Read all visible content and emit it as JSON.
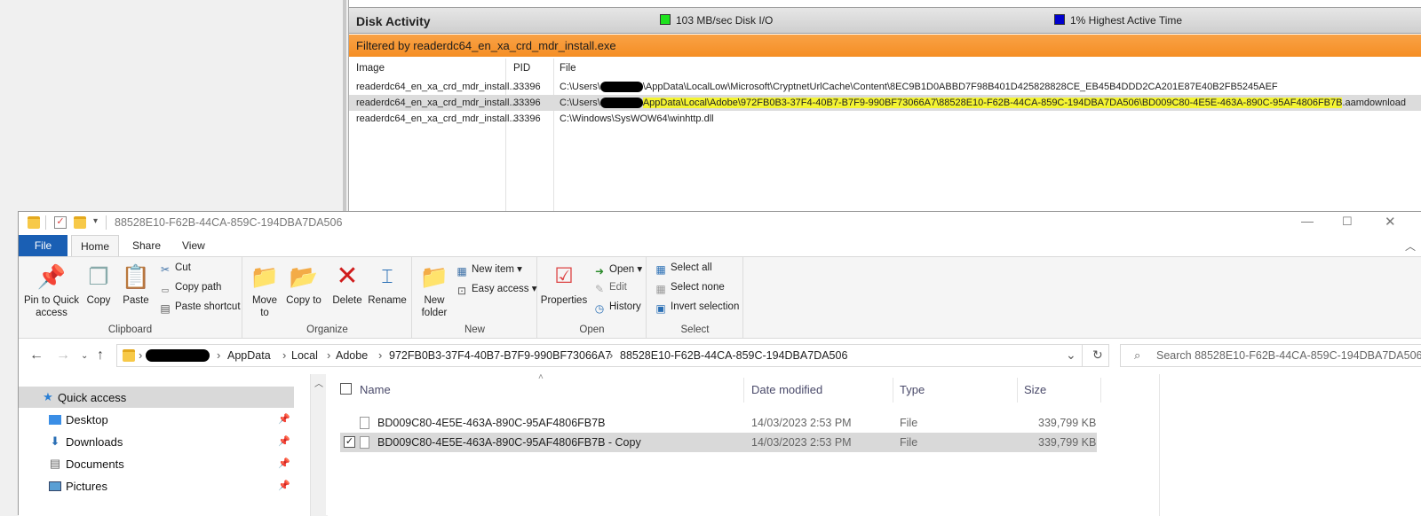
{
  "resmon": {
    "title": "Disk Activity",
    "io_stat": "103 MB/sec Disk I/O",
    "active_stat": "1% Highest Active Time",
    "filter": "Filtered by readerdc64_en_xa_crd_mdr_install.exe",
    "columns": [
      "Image",
      "PID",
      "File"
    ],
    "rows": [
      {
        "image": "readerdc64_en_xa_crd_mdr_install...",
        "pid": "33396",
        "file_pre": "C:\\Users\\",
        "file_hl": "",
        "file_post": "\\AppData\\LocalLow\\Microsoft\\CryptnetUrlCache\\Content\\8EC9B1D0ABBD7F98B401D425828828CE_EB45B4DDD2CA201E87E40B2FB5245AEF"
      },
      {
        "image": "readerdc64_en_xa_crd_mdr_install...",
        "pid": "33396",
        "file_pre": "C:\\Users\\",
        "file_hl": "AppData\\Local\\Adobe\\972FB0B3-37F4-40B7-B7F9-990BF73066A7\\88528E10-F62B-44CA-859C-194DBA7DA506\\BD009C80-4E5E-463A-890C-95AF4806FB7B",
        "file_post": ".aamdownload"
      },
      {
        "image": "readerdc64_en_xa_crd_mdr_install...",
        "pid": "33396",
        "file_pre": "C:\\Windows\\SysWOW64\\winhttp.dll",
        "file_hl": "",
        "file_post": ""
      }
    ]
  },
  "explorer": {
    "title": "88528E10-F62B-44CA-859C-194DBA7DA506",
    "tabs": {
      "file": "File",
      "home": "Home",
      "share": "Share",
      "view": "View"
    },
    "ribbon": {
      "clipboard": {
        "label": "Clipboard",
        "pin": "Pin to Quick access",
        "copy": "Copy",
        "paste": "Paste",
        "cut": "Cut",
        "copy_path": "Copy path",
        "paste_shortcut": "Paste shortcut"
      },
      "organize": {
        "label": "Organize",
        "move_to": "Move to",
        "copy_to": "Copy to",
        "delete": "Delete",
        "rename": "Rename"
      },
      "new": {
        "label": "New",
        "new_folder": "New folder",
        "new_item": "New item",
        "easy_access": "Easy access"
      },
      "open": {
        "label": "Open",
        "properties": "Properties",
        "open": "Open",
        "edit": "Edit",
        "history": "History"
      },
      "select": {
        "label": "Select",
        "select_all": "Select all",
        "select_none": "Select none",
        "invert": "Invert selection"
      }
    },
    "breadcrumb": [
      "AppData",
      "Local",
      "Adobe",
      "972FB0B3-37F4-40B7-B7F9-990BF73066A7",
      "88528E10-F62B-44CA-859C-194DBA7DA506"
    ],
    "search_placeholder": "Search 88528E10-F62B-44CA-859C-194DBA7DA506",
    "nav": [
      {
        "label": "Quick access",
        "icon": "star-icon"
      },
      {
        "label": "Desktop",
        "icon": "desktop-icon"
      },
      {
        "label": "Downloads",
        "icon": "download-icon"
      },
      {
        "label": "Documents",
        "icon": "documents-icon"
      },
      {
        "label": "Pictures",
        "icon": "pictures-icon"
      }
    ],
    "file_columns": {
      "name": "Name",
      "date": "Date modified",
      "type": "Type",
      "size": "Size"
    },
    "files": [
      {
        "name": "BD009C80-4E5E-463A-890C-95AF4806FB7B",
        "date": "14/03/2023 2:53 PM",
        "type": "File",
        "size": "339,799 KB",
        "checked": false
      },
      {
        "name": "BD009C80-4E5E-463A-890C-95AF4806FB7B - Copy",
        "date": "14/03/2023 2:53 PM",
        "type": "File",
        "size": "339,799 KB",
        "checked": true
      }
    ]
  },
  "colors": {
    "accent": "#1a5fb4",
    "filter_bar": "#f5911f",
    "highlight": "#f4f432"
  }
}
